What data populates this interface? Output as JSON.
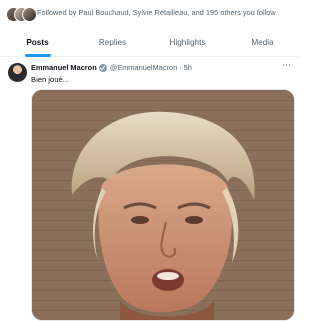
{
  "followed": {
    "text": "Followed by Paul Bouchaud, Sylvie Retailleau, and 195 others you follow"
  },
  "tabs": [
    {
      "label": "Posts",
      "active": true
    },
    {
      "label": "Replies",
      "active": false
    },
    {
      "label": "Highlights",
      "active": false
    },
    {
      "label": "Media",
      "active": false
    }
  ],
  "post": {
    "author": "Emmanuel Macron",
    "handle": "@EmmanuelMacron",
    "dot": "·",
    "time": "5h",
    "more_icon": "more-horizontal-icon",
    "text": "Bien joué..."
  },
  "colors": {
    "accent": "#1d9bf0",
    "secondary_text": "#536471",
    "primary_text": "#0f1419"
  }
}
